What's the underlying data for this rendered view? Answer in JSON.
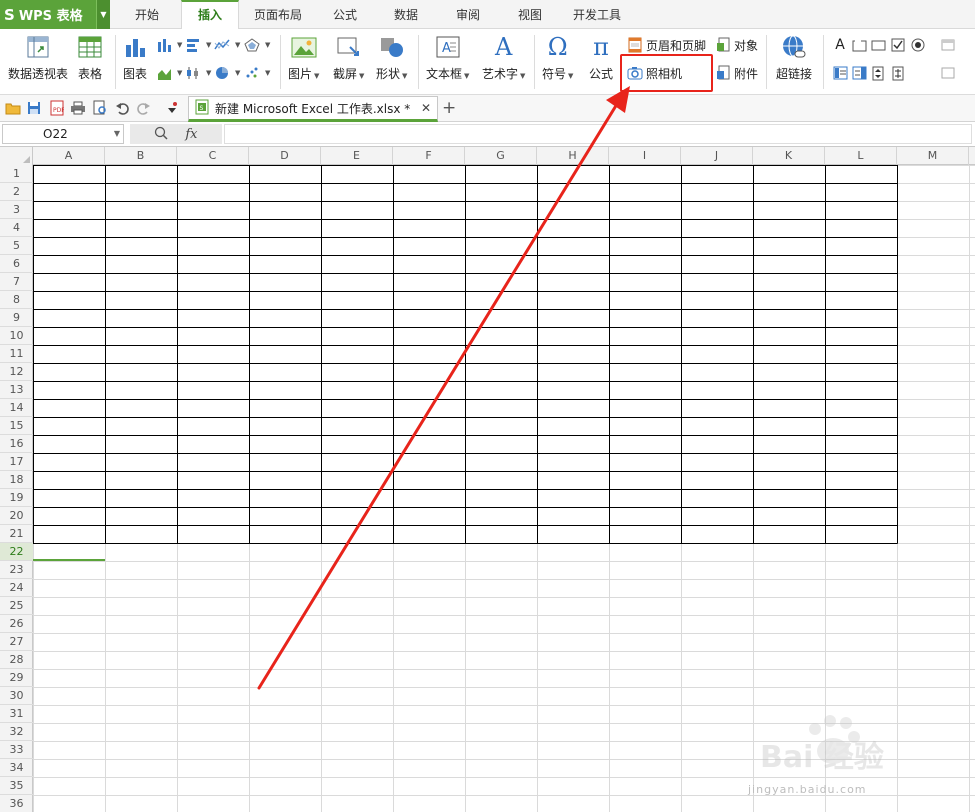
{
  "app": {
    "name": "WPS 表格",
    "tabs": [
      "开始",
      "插入",
      "页面布局",
      "公式",
      "数据",
      "审阅",
      "视图",
      "开发工具"
    ],
    "active_tab": "插入",
    "accent_color": "#5ba33a",
    "highlight_color": "#e8241b"
  },
  "ribbon": {
    "pivot_table": "数据透视表",
    "table": "表格",
    "chart": "图表",
    "picture": "图片",
    "screenshot": "截屏",
    "shapes": "形状",
    "textbox": "文本框",
    "wordart": "艺术字",
    "symbol": "符号",
    "symbol_glyph": "Ω",
    "equation": "公式",
    "equation_glyph": "π",
    "header_footer": "页眉和页脚",
    "camera": "照相机",
    "object": "对象",
    "attachment": "附件",
    "hyperlink": "超链接",
    "wordart_glyph": "A",
    "text_glyph": "A"
  },
  "document": {
    "tab_title": "新建 Microsoft Excel 工作表.xlsx *"
  },
  "formula_bar": {
    "name_box": "O22",
    "fx_label": "fx",
    "formula": ""
  },
  "sheet": {
    "columns": [
      "A",
      "B",
      "C",
      "D",
      "E",
      "F",
      "G",
      "H",
      "I",
      "J",
      "K",
      "L",
      "M"
    ],
    "rows": [
      "1",
      "2",
      "3",
      "4",
      "5",
      "6",
      "7",
      "8",
      "9",
      "10",
      "11",
      "12",
      "13",
      "14",
      "15",
      "16",
      "17",
      "18",
      "19",
      "20",
      "21",
      "22",
      "23",
      "24",
      "25",
      "26",
      "27",
      "28",
      "29",
      "30",
      "31",
      "32",
      "33",
      "34",
      "35",
      "36"
    ],
    "selected_row": "22",
    "bordered_range": "A1:L21"
  },
  "watermark": {
    "brand": "Bai 经验",
    "url": "jingyan.baidu.com"
  }
}
